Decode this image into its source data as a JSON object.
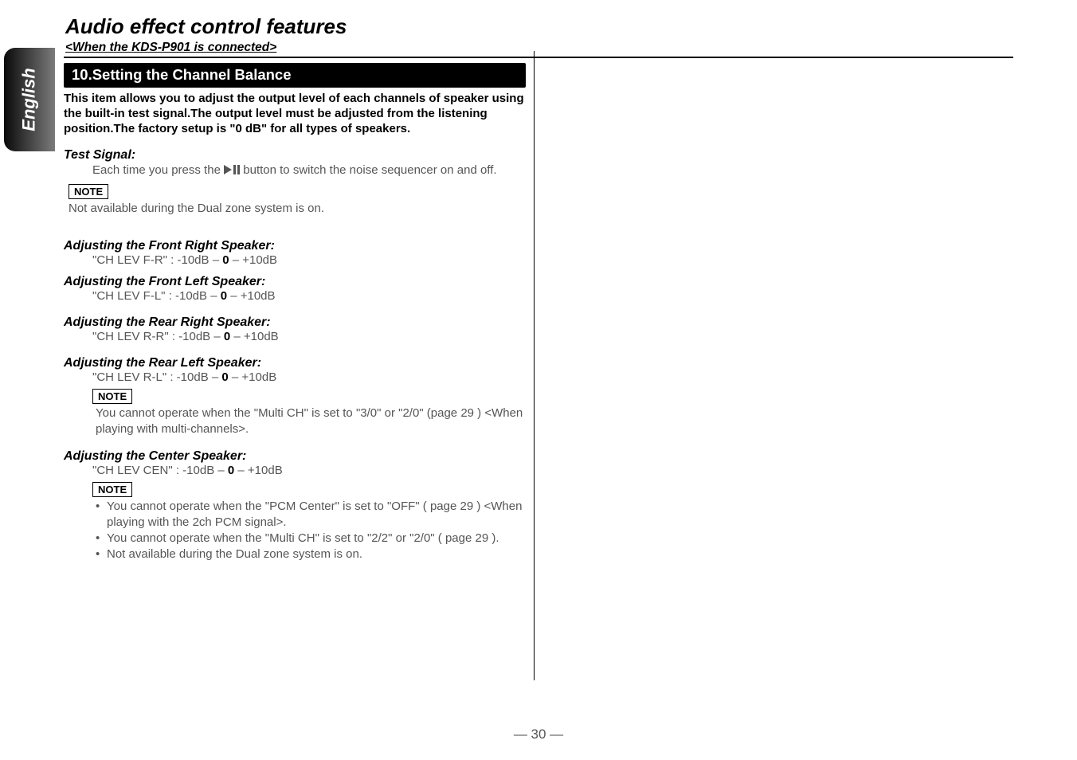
{
  "sidebar": {
    "label": "English"
  },
  "title": "Audio effect control features",
  "subtitle": "<When the KDS-P901 is connected>",
  "section_bar": "10.Setting the Channel Balance",
  "intro": "This item allows you to adjust the output level of each channels of speaker using the built-in test signal.The output level must be adjusted from the listening position.The factory setup is \"0 dB\" for all types of speakers.",
  "test_signal": {
    "heading": "Test Signal:",
    "line1": "Each time you press the ",
    "line2": " button to switch the noise sequencer on and off.",
    "note_label": "NOTE",
    "note_text": "Not available during the Dual zone system is on."
  },
  "fr": {
    "heading": "Adjusting the Front Right Speaker:",
    "prefix": "\"CH LEV F-R\" : -10dB  –  ",
    "zero": "0",
    "suffix": "  –  +10dB"
  },
  "fl": {
    "heading": "Adjusting the Front Left Speaker:",
    "prefix": "\"CH LEV F-L\" : -10dB  –  ",
    "zero": "0",
    "suffix": "  –  +10dB"
  },
  "rr": {
    "heading": "Adjusting the Rear Right Speaker:",
    "prefix": "\"CH LEV R-R\" : -10dB  –  ",
    "zero": "0",
    "suffix": "  –  +10dB"
  },
  "rl": {
    "heading": "Adjusting the Rear Left Speaker:",
    "prefix": "\"CH LEV R-L\" : -10dB  –  ",
    "zero": "0",
    "suffix": "  –  +10dB",
    "note_label": "NOTE",
    "note_text": "You cannot operate when the \"Multi CH\" is set to \"3/0\" or \"2/0\" (page 29 ) <When playing with multi-channels>."
  },
  "cen": {
    "heading": "Adjusting the Center Speaker:",
    "prefix": "\"CH LEV CEN\" : -10dB  –  ",
    "zero": "0",
    "suffix": "  –  +10dB",
    "note_label": "NOTE",
    "bullets": [
      "You cannot operate when the \"PCM Center\" is set to \"OFF\" ( page  29 ) <When playing with the 2ch PCM signal>.",
      "You cannot operate when the \"Multi CH\" is set to \"2/2\" or \"2/0\" ( page 29 ).",
      "Not available during the Dual zone system is on."
    ]
  },
  "pagenum": "— 30 —"
}
